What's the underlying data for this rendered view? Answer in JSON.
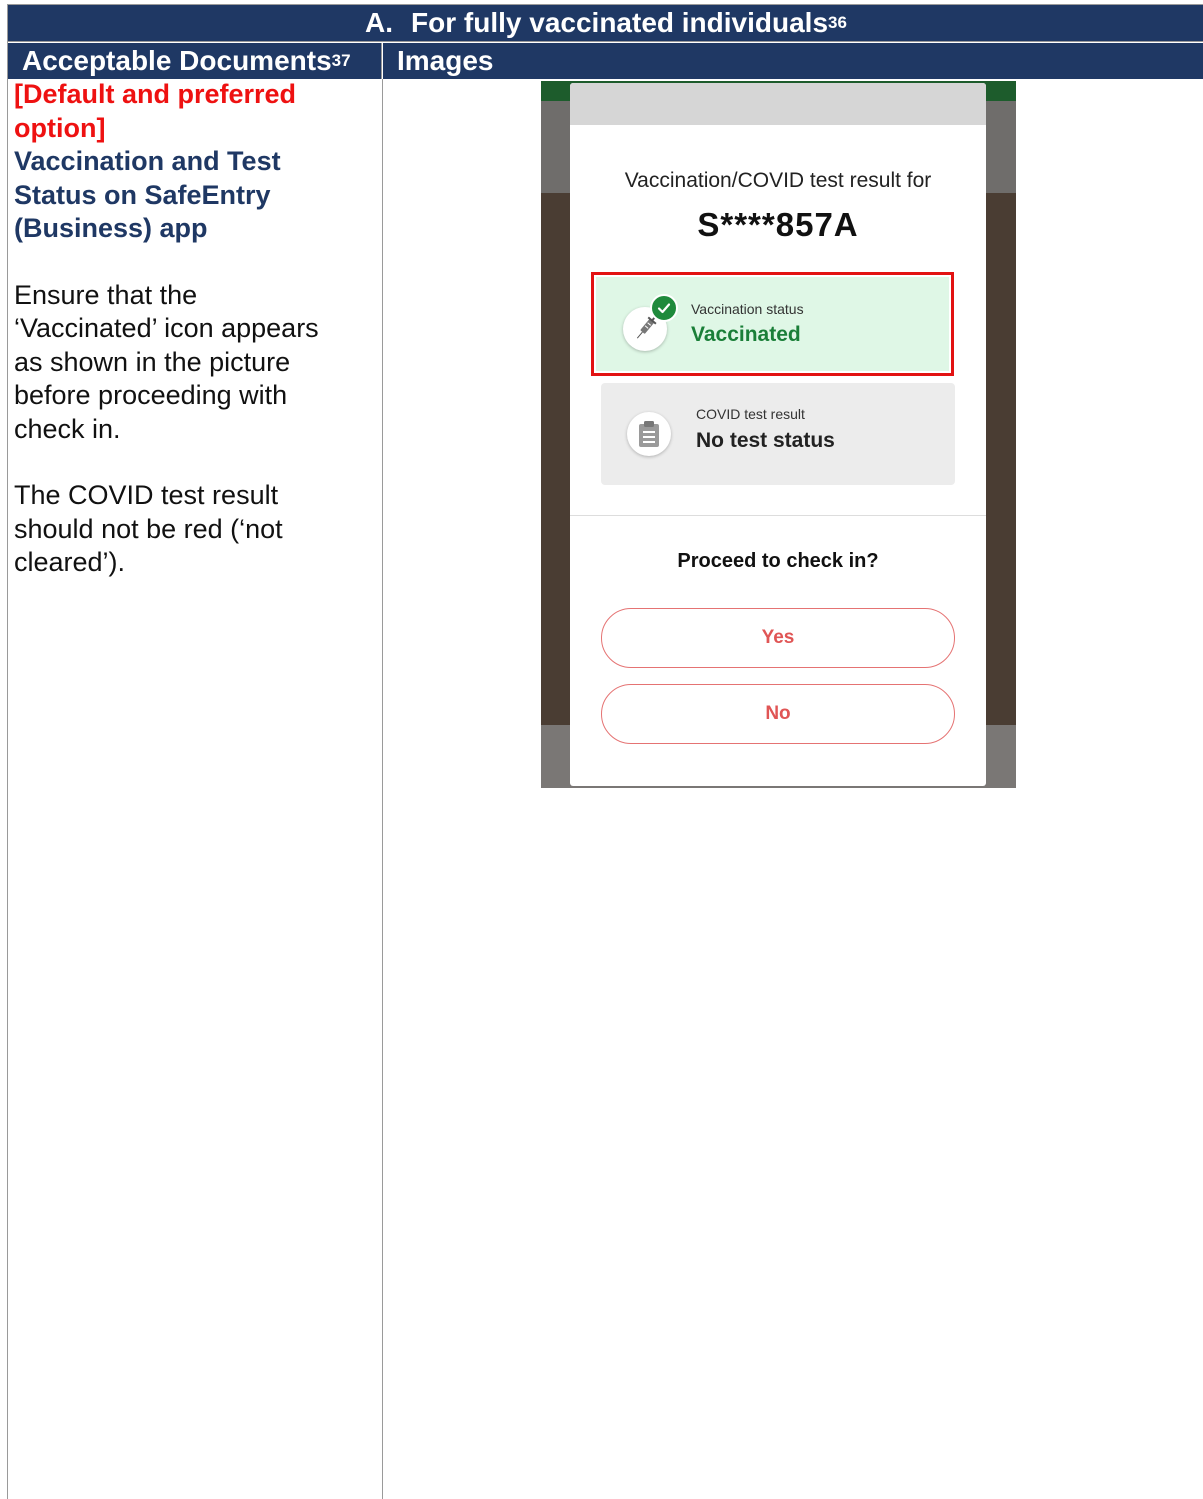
{
  "table": {
    "section_number": "A.",
    "section_title": "For fully vaccinated individuals",
    "section_footnote": "36",
    "col1_header": "Acceptable Documents",
    "col1_footnote": "37",
    "col2_header": "Images"
  },
  "left": {
    "tag_line1": "[Default and preferred",
    "tag_line2": "option]",
    "heading_line1": "Vaccination and Test",
    "heading_line2": "Status on SafeEntry",
    "heading_line3": "(Business) app",
    "para1": [
      "Ensure that the",
      "‘Vaccinated’ icon appears",
      "as shown in the picture",
      "before proceeding with",
      "check in."
    ],
    "para2": [
      "The COVID test result",
      "should not be red (‘not",
      "cleared’)."
    ]
  },
  "phone": {
    "result_for": "Vaccination/COVID test result for",
    "id": "S****857A",
    "vaccination_label": "Vaccination status",
    "vaccination_value": "Vaccinated",
    "test_label": "COVID test result",
    "test_value": "No test status",
    "proceed_question": "Proceed to check in?",
    "yes_label": "Yes",
    "no_label": "No",
    "colors": {
      "vaccinated_green": "#1a7f38",
      "highlight_red": "#e21212",
      "button_red": "#e05555"
    },
    "icons": [
      "syringe-icon",
      "check-badge-icon",
      "clipboard-icon"
    ]
  }
}
